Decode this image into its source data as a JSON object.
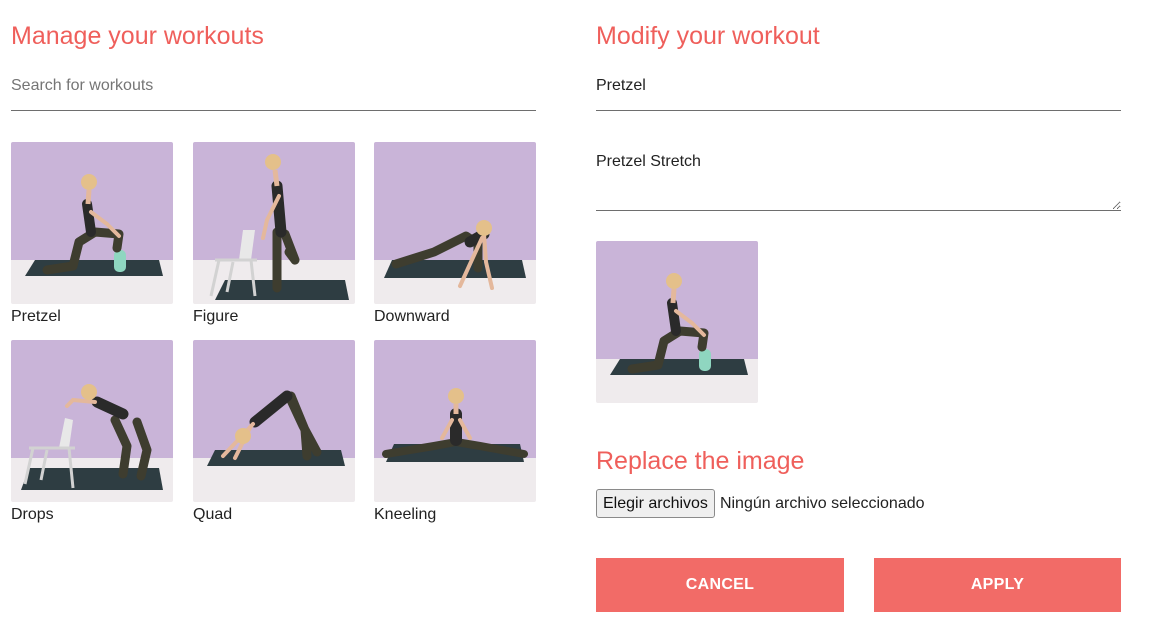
{
  "left_panel": {
    "title": "Manage your workouts",
    "search_placeholder": "Search for workouts",
    "workouts": [
      {
        "label": "Pretzel",
        "icon": "kneeling-stretch-with-block"
      },
      {
        "label": "Figure",
        "icon": "standing-stretch-with-chair"
      },
      {
        "label": "Downward",
        "icon": "lunge-hands-on-floor"
      },
      {
        "label": "Drops",
        "icon": "bent-over-with-chair"
      },
      {
        "label": "Quad",
        "icon": "downward-dog"
      },
      {
        "label": "Kneeling",
        "icon": "seated-straddle"
      }
    ]
  },
  "right_panel": {
    "title": "Modify your workout",
    "name_value": "Pretzel",
    "description_value": "Pretzel Stretch",
    "preview_icon": "kneeling-stretch-with-block",
    "replace_title": "Replace the image",
    "file_button_label": "Elegir archivos",
    "file_status": "Ningún archivo seleccionado",
    "cancel_label": "CANCEL",
    "apply_label": "APPLY"
  },
  "colors": {
    "accent": "#ef5f5b",
    "button": "#f26b67",
    "wall": "#c8b3d7",
    "floor": "#efebed",
    "mat": "#2e3d42"
  }
}
